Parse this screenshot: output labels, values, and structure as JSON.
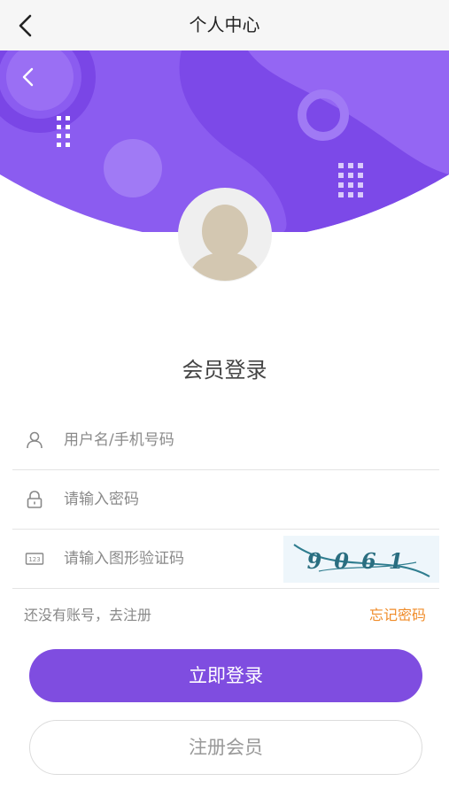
{
  "header": {
    "title": "个人中心",
    "back_icon": "chevron-left-icon"
  },
  "hero": {
    "back_icon": "chevron-left-icon",
    "bg_color": "#8b5cf0",
    "accent_color": "#a27af5"
  },
  "login": {
    "title": "会员登录",
    "username_placeholder": "用户名/手机号码",
    "password_placeholder": "请输入密码",
    "captcha_placeholder": "请输入图形验证码",
    "captcha_text": "9061",
    "no_account_link": "还没有账号，去注册",
    "forgot_link": "忘记密码",
    "login_button": "立即登录",
    "register_button": "注册会员"
  },
  "colors": {
    "primary": "#7f4de0",
    "link_orange": "#f08c2a"
  }
}
